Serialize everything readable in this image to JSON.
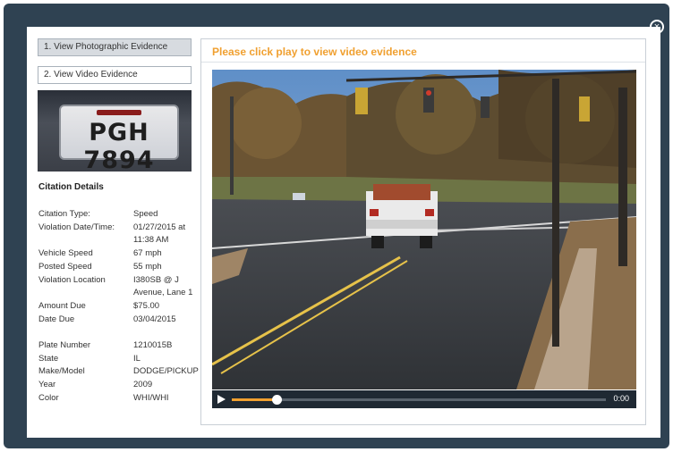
{
  "modal": {
    "close_icon": "close-icon",
    "close_glyph": "×"
  },
  "evidence_buttons": {
    "photo": "1. View Photographic Evidence",
    "video": "2. View Video Evidence"
  },
  "plate_image": {
    "plate_text": "PGH 7894"
  },
  "citation": {
    "title": "Citation Details",
    "labels": [
      "Citation Type:",
      "Violation Date/Time:",
      "",
      "Vehicle Speed",
      "Posted Speed",
      "Violation Location",
      "",
      "Amount Due",
      "Date Due",
      "",
      "Plate Number",
      "State",
      "Make/Model",
      "Year",
      "Color"
    ],
    "values": [
      "Speed",
      "01/27/2015 at",
      "11:38 AM",
      "67 mph",
      "55 mph",
      "I380SB @ J",
      "Avenue, Lane 1",
      "$75.00",
      "03/04/2015",
      "",
      "1210015B",
      "IL",
      "DODGE/PICKUP",
      "2009",
      "WHI/WHI"
    ]
  },
  "video": {
    "title": "Please click play to view video evidence",
    "play_icon": "play-icon",
    "progress_fraction": 0.12,
    "time": "0:00"
  },
  "colors": {
    "frame_bg": "#2f4252",
    "accent_orange": "#f0a030",
    "control_bar": "#1f2933"
  }
}
